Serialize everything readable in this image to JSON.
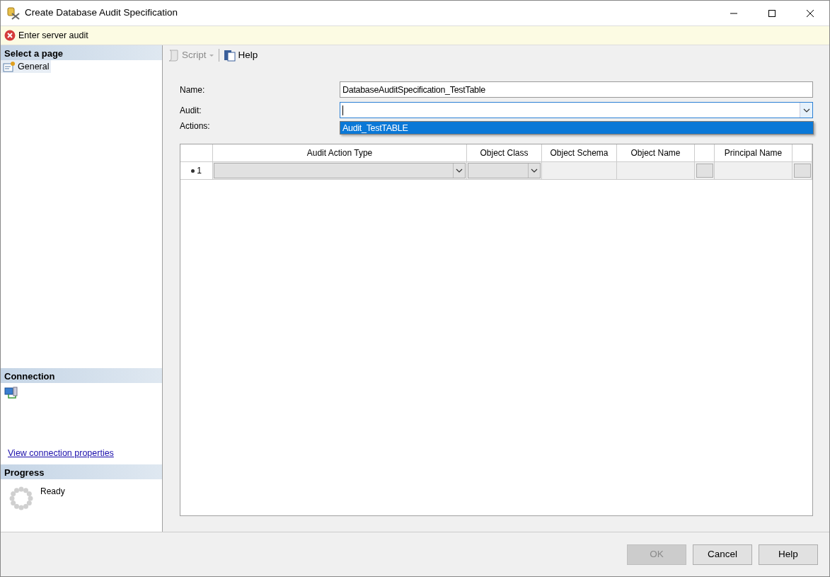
{
  "window": {
    "title": "Create Database Audit Specification"
  },
  "message": {
    "kind": "error",
    "text": "Enter server audit"
  },
  "sidebar": {
    "select_page": {
      "title": "Select a page",
      "pages": [
        {
          "label": "General",
          "selected": true
        }
      ]
    },
    "connection": {
      "title": "Connection",
      "link": "View connection properties"
    },
    "progress": {
      "title": "Progress",
      "status": "Ready"
    }
  },
  "toolbar": [
    {
      "label": "Script",
      "kind": "script",
      "disabled": true
    },
    {
      "label": "Help",
      "kind": "help",
      "disabled": false
    }
  ],
  "form": {
    "name": {
      "label": "Name:",
      "value": "DatabaseAuditSpecification_TestTable"
    },
    "audit": {
      "label": "Audit:",
      "expanded": true,
      "options": [
        {
          "label": "Audit_TestTABLE",
          "selected": true
        }
      ]
    },
    "actions_label": "Actions:"
  },
  "grid": {
    "columns": [
      {
        "kind": "header"
      },
      {
        "kind": "dropdown",
        "label": "Audit Action Type"
      },
      {
        "kind": "dropdown",
        "label": "Object Class"
      },
      {
        "kind": "text",
        "label": "Object Schema"
      },
      {
        "kind": "text",
        "label": "Object Name"
      },
      {
        "kind": "button"
      },
      {
        "kind": "text",
        "label": "Principal Name"
      },
      {
        "kind": "button"
      }
    ],
    "rows": [
      {
        "number": "1",
        "new_row": true
      }
    ]
  },
  "buttons": [
    {
      "label": "OK",
      "disabled": true
    },
    {
      "label": "Cancel",
      "disabled": false
    },
    {
      "label": "Help",
      "disabled": false
    }
  ]
}
